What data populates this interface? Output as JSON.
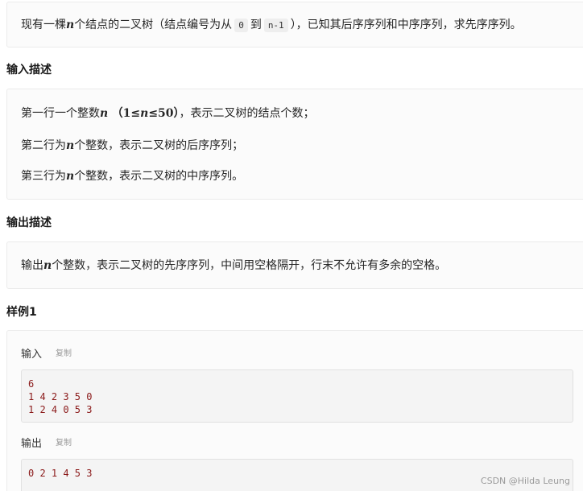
{
  "description": {
    "pre": "现有一棵",
    "var_n": "n",
    "mid": "个结点的二叉树（结点编号为从",
    "code_start": "0",
    "to": "到",
    "code_end": "n-1",
    "post": "），已知其后序序列和中序序列，求先序序列。"
  },
  "input_section": {
    "heading": "输入描述",
    "line1": {
      "pre": "第一行一个整数",
      "var_n": "n",
      "range_open": "（",
      "range_lo": "1≤",
      "range_var": "n",
      "range_hi": "≤50",
      "range_close": "）",
      "post": "，表示二叉树的结点个数；"
    },
    "line2": {
      "pre": "第二行为",
      "var_n": "n",
      "post": "个整数，表示二叉树的后序序列；"
    },
    "line3": {
      "pre": "第三行为",
      "var_n": "n",
      "post": "个整数，表示二叉树的中序序列。"
    }
  },
  "output_section": {
    "heading": "输出描述",
    "line": {
      "pre": "输出",
      "var_n": "n",
      "post": "个整数，表示二叉树的先序序列，中间用空格隔开，行末不允许有多余的空格。"
    }
  },
  "sample": {
    "heading": "样例1",
    "input_label": "输入",
    "output_label": "输出",
    "copy_label": "复制",
    "input_text": "6\n1 4 2 3 5 0\n1 2 4 0 5 3",
    "output_text": "0 2 1 4 5 3"
  },
  "watermark": "CSDN @Hilda Leung"
}
